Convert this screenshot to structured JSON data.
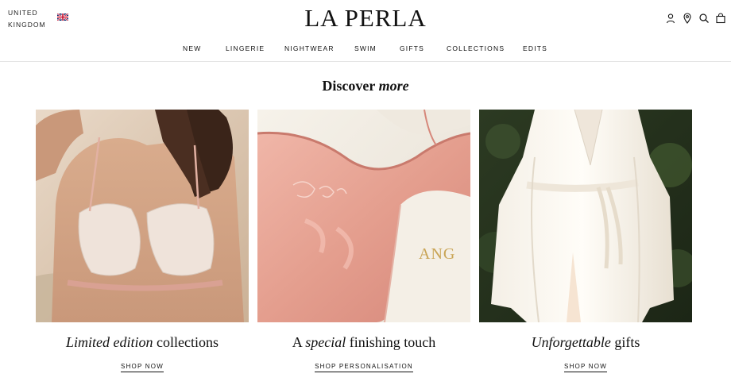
{
  "header": {
    "region_line1": "UNITED",
    "region_line2": "KINGDOM",
    "flag_icon": "uk-flag-icon",
    "logo": "LA PERLA",
    "icons": [
      "account-icon",
      "store-locator-icon",
      "search-icon",
      "bag-icon"
    ]
  },
  "nav": {
    "items": [
      "NEW",
      "LINGERIE",
      "NIGHTWEAR",
      "SWIM",
      "GIFTS",
      "COLLECTIONS",
      "EDITS"
    ]
  },
  "section": {
    "title_plain": "Discover ",
    "title_italic": "more"
  },
  "cards": [
    {
      "caption_italic": "Limited edition",
      "caption_plain": " collections",
      "cta": "SHOP NOW"
    },
    {
      "caption_prefix": "A ",
      "caption_italic": "special",
      "caption_plain": " finishing touch",
      "cta": "SHOP PERSONALISATION",
      "embroidery": "ANG"
    },
    {
      "caption_italic": "Unforgettable",
      "caption_plain": " gifts",
      "cta": "SHOP NOW"
    }
  ],
  "colors": {
    "text": "#111111",
    "divider": "#e4e4e4",
    "blush": "#e9a79a",
    "ivory": "#f3efe8"
  }
}
